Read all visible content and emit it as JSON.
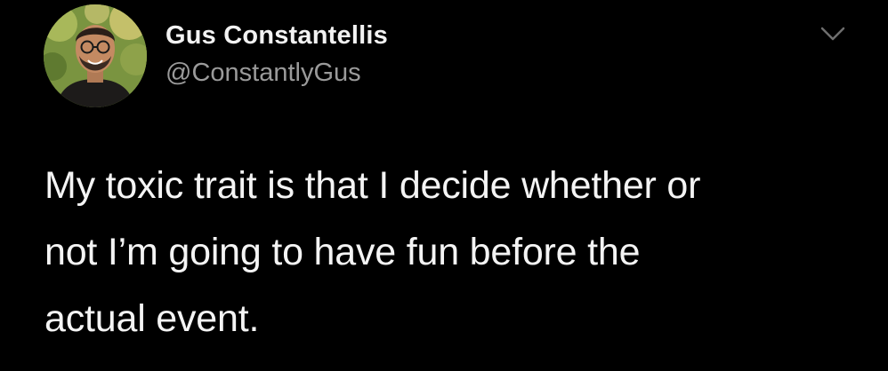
{
  "tweet": {
    "author_name": "Gus Constantellis",
    "author_handle": "@ConstantlyGus",
    "text": "My toxic trait is that I decide whether or\nnot I’m going to have fun before the\nactual event."
  },
  "icons": {
    "avatar": "profile-photo",
    "more": "chevron-down-icon"
  },
  "colors": {
    "background": "#000000",
    "name": "#f2f2f2",
    "handle": "#9a9a9a",
    "text": "#f4f4f4"
  }
}
